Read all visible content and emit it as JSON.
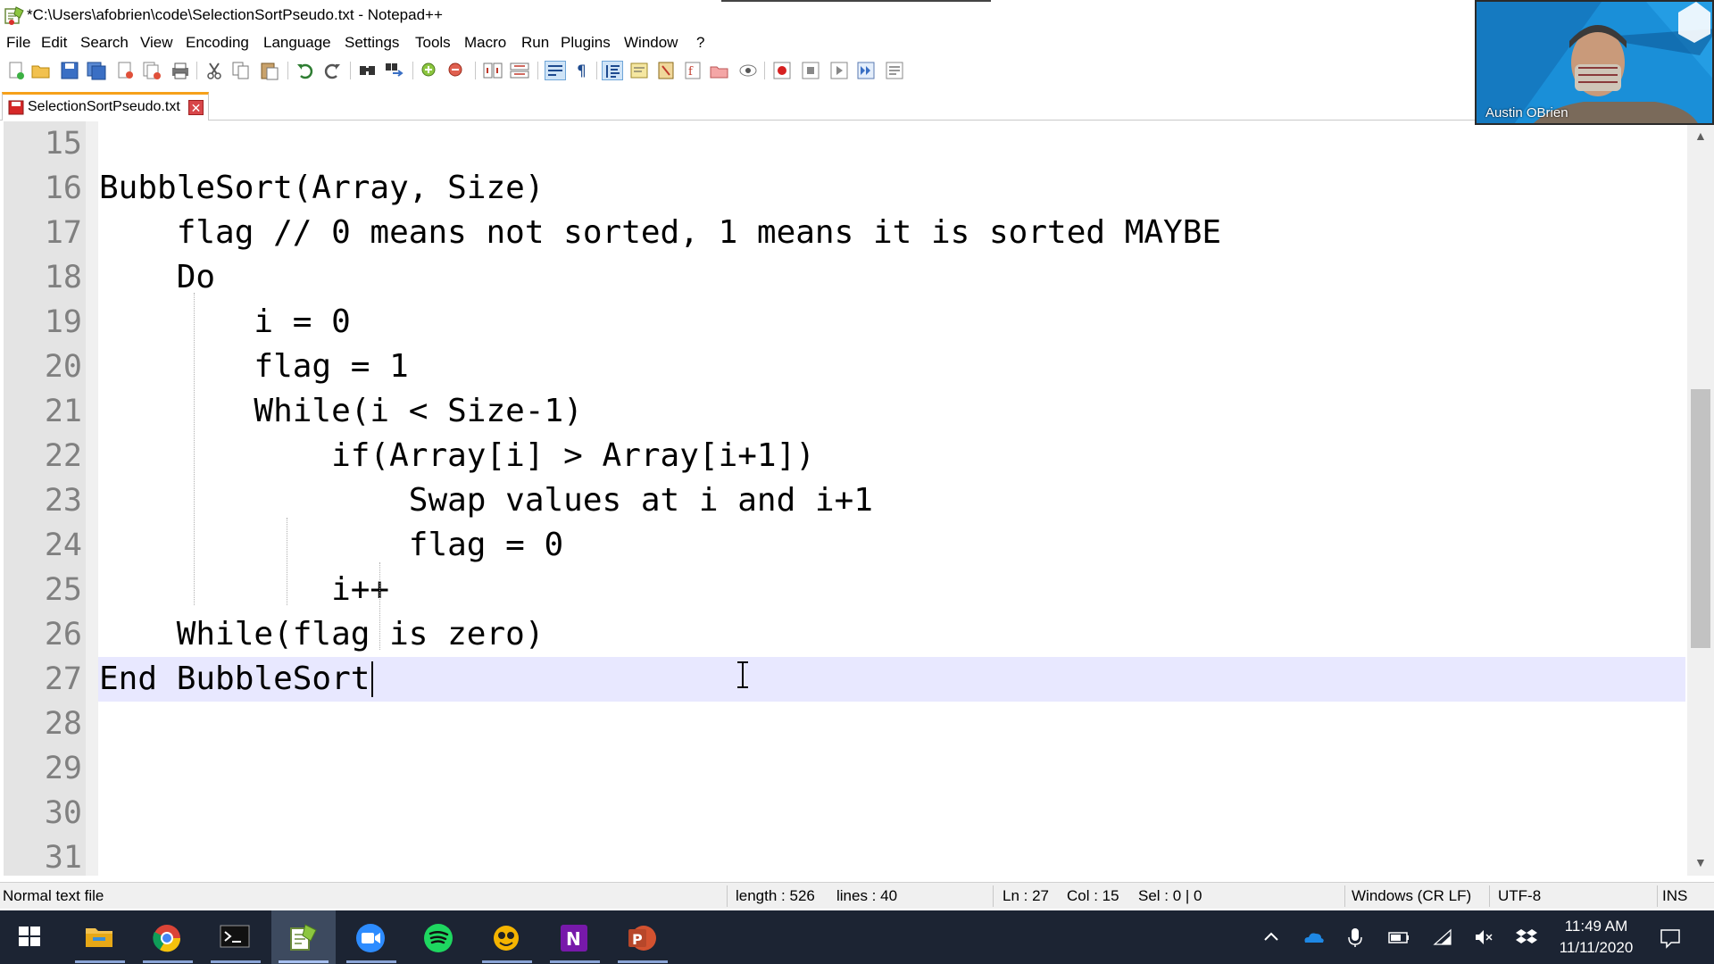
{
  "window": {
    "title": "*C:\\Users\\afobrien\\code\\SelectionSortPseudo.txt - Notepad++"
  },
  "menu": [
    "File",
    "Edit",
    "Search",
    "View",
    "Encoding",
    "Language",
    "Settings",
    "Tools",
    "Macro",
    "Run",
    "Plugins",
    "Window",
    "?"
  ],
  "toolbar_icons": [
    "new-file-icon",
    "open-file-icon",
    "save-icon",
    "save-all-icon",
    "close-icon",
    "close-all-icon",
    "print-icon",
    "cut-icon",
    "copy-icon",
    "paste-icon",
    "undo-icon",
    "redo-icon",
    "find-icon",
    "replace-icon",
    "zoom-in-icon",
    "zoom-out-icon",
    "sync-vertical-icon",
    "sync-horizontal-icon",
    "word-wrap-icon",
    "show-all-chars-icon",
    "indent-guide-icon",
    "udl-icon",
    "document-map-icon",
    "function-list-icon",
    "folder-workspace-icon",
    "monitoring-icon",
    "record-macro-icon",
    "stop-record-icon",
    "play-macro-icon",
    "run-macro-multiple-icon",
    "save-macro-icon"
  ],
  "tab": {
    "label": "SelectionSortPseudo.txt",
    "close_glyph": "✕"
  },
  "editor": {
    "current_line": 27,
    "caret_column": 15,
    "lines": [
      {
        "num": "15",
        "text": ""
      },
      {
        "num": "16",
        "text": "BubbleSort(Array, Size)"
      },
      {
        "num": "17",
        "text": "    flag // 0 means not sorted, 1 means it is sorted MAYBE"
      },
      {
        "num": "18",
        "text": "    Do"
      },
      {
        "num": "19",
        "text": "        i = 0"
      },
      {
        "num": "20",
        "text": "        flag = 1"
      },
      {
        "num": "21",
        "text": "        While(i < Size-1)"
      },
      {
        "num": "22",
        "text": "            if(Array[i] > Array[i+1])"
      },
      {
        "num": "23",
        "text": "                Swap values at i and i+1"
      },
      {
        "num": "24",
        "text": "                flag = 0"
      },
      {
        "num": "25",
        "text": "            i++"
      },
      {
        "num": "26",
        "text": "    While(flag is zero)"
      },
      {
        "num": "27",
        "text": "End BubbleSort"
      },
      {
        "num": "28",
        "text": ""
      },
      {
        "num": "29",
        "text": ""
      },
      {
        "num": "30",
        "text": ""
      },
      {
        "num": "31",
        "text": ""
      }
    ]
  },
  "status": {
    "file_type": "Normal text file",
    "length": "length : 526",
    "lines": "lines : 40",
    "ln": "Ln : 27",
    "col": "Col : 15",
    "sel": "Sel : 0 | 0",
    "eol": "Windows (CR LF)",
    "encoding": "UTF-8",
    "mode": "INS"
  },
  "video": {
    "participant": "Austin OBrien"
  },
  "taskbar": {
    "apps": [
      "start-icon",
      "file-explorer-icon",
      "chrome-icon",
      "terminal-icon",
      "notepadpp-icon",
      "zoom-icon",
      "spotify-icon",
      "git-app-icon",
      "onenote-icon",
      "powerpoint-icon"
    ],
    "active_app": "notepadpp-icon",
    "tray_icons": [
      "show-hidden-icons-icon",
      "onedrive-icon",
      "microphone-icon",
      "battery-icon",
      "wifi-icon",
      "volume-muted-icon",
      "dropbox-icon"
    ],
    "time": "11:49 AM",
    "date": "11/11/2020"
  },
  "colors": {
    "current_line": "#e8e8ff",
    "tab_accent": "#f6a11a",
    "taskbar": "#1c2433",
    "video_bg": "#1a8fd8"
  }
}
